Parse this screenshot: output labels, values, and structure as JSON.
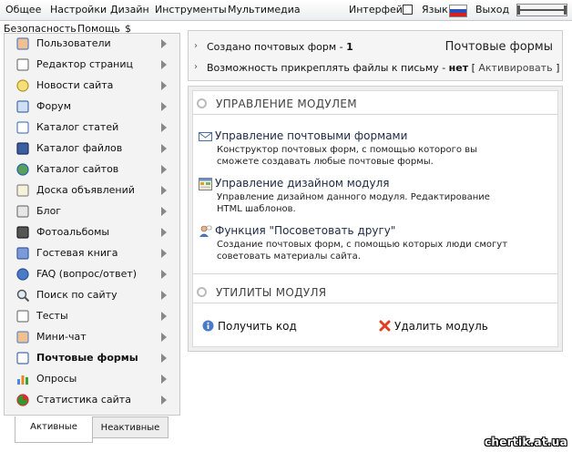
{
  "top_menu": {
    "items": [
      "Общее",
      "Настройки",
      "Дизайн",
      "Инструменты",
      "Мультимедиа"
    ],
    "interface_label": "Интерфейс",
    "language_label": "Язык",
    "exit_label": "Выход",
    "second_row": [
      "Безопасность",
      "Помощь",
      "$"
    ]
  },
  "sidebar": {
    "items": [
      {
        "label": "Пользователи",
        "icon": "users-icon"
      },
      {
        "label": "Редактор страниц",
        "icon": "page-editor-icon"
      },
      {
        "label": "Новости сайта",
        "icon": "news-bulb-icon"
      },
      {
        "label": "Форум",
        "icon": "forum-icon"
      },
      {
        "label": "Каталог статей",
        "icon": "articles-icon"
      },
      {
        "label": "Каталог файлов",
        "icon": "files-disk-icon"
      },
      {
        "label": "Каталог сайтов",
        "icon": "sites-globe-icon"
      },
      {
        "label": "Доска объявлений",
        "icon": "board-icon"
      },
      {
        "label": "Блог",
        "icon": "blog-icon"
      },
      {
        "label": "Фотоальбомы",
        "icon": "camera-icon"
      },
      {
        "label": "Гостевая книга",
        "icon": "guestbook-icon"
      },
      {
        "label": "FAQ (вопрос/ответ)",
        "icon": "faq-question-icon"
      },
      {
        "label": "Поиск по сайту",
        "icon": "search-icon"
      },
      {
        "label": "Тесты",
        "icon": "tests-icon"
      },
      {
        "label": "Мини-чат",
        "icon": "chat-icon"
      },
      {
        "label": "Почтовые формы",
        "icon": "mail-forms-icon"
      },
      {
        "label": "Опросы",
        "icon": "polls-chart-icon"
      },
      {
        "label": "Статистика сайта",
        "icon": "stats-pie-icon"
      }
    ],
    "active_index": 15,
    "tabs": {
      "active": "Активные",
      "inactive": "Неактивные"
    }
  },
  "info": {
    "created_label": "Создано почтовых форм - ",
    "created_value": "1",
    "attach_label": "Возможность прикреплять файлы к письму - ",
    "attach_value": "нет",
    "activate_link": "Активировать",
    "title": "Почтовые формы"
  },
  "panel": {
    "module_heading": "УПРАВЛЕНИЕ МОДУЛЕМ",
    "modules": [
      {
        "title": "Управление почтовыми формами",
        "desc": "Конструктор почтовых форм, с помощью которого вы сможете создавать любые почтовые формы.",
        "icon": "envelope-icon"
      },
      {
        "title": "Управление дизайном модуля",
        "desc": "Управление дизайном данного модуля. Редактирование HTML шаблонов.",
        "icon": "design-window-icon"
      },
      {
        "title": "Функция \"Посоветовать другу\"",
        "desc": "Создание почтовых форм, с помощью которых люди смогут советовать материалы сайта.",
        "icon": "recommend-friend-icon"
      }
    ],
    "utils_heading": "УТИЛИТЫ МОДУЛЯ",
    "get_code": "Получить код",
    "delete_module": "Удалить модуль"
  },
  "watermark": "chertik.at.ua"
}
